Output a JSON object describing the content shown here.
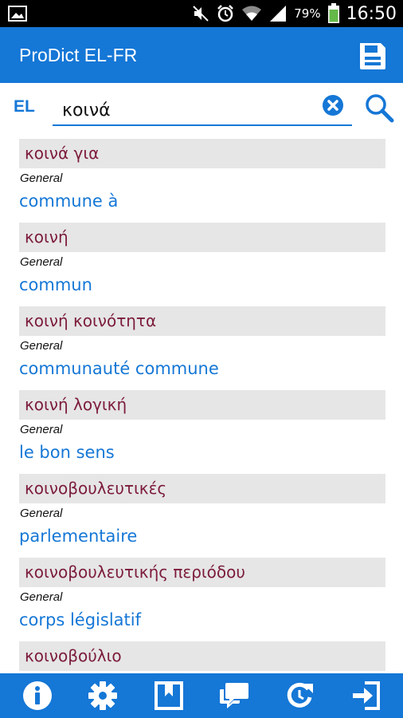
{
  "status_bar": {
    "battery_percent": "79%",
    "time": "16:50",
    "icons": [
      "image-icon",
      "mute-icon",
      "alarm-icon",
      "wifi-icon",
      "signal-icon",
      "battery-icon"
    ]
  },
  "app_bar": {
    "title": "ProDict EL-FR",
    "save_icon": "save-icon"
  },
  "search": {
    "language": "EL",
    "value": "κοινά",
    "clear_icon": "clear-icon",
    "search_icon": "search-icon"
  },
  "results": [
    {
      "headword": "κοινά για",
      "category": "General",
      "translation": "commune à"
    },
    {
      "headword": "κοινή",
      "category": "General",
      "translation": "commun"
    },
    {
      "headword": "κοινή κοινότητα",
      "category": "General",
      "translation": "communauté commune"
    },
    {
      "headword": "κοινή λογική",
      "category": "General",
      "translation": "le bon sens"
    },
    {
      "headword": "κοινοβουλευτικές",
      "category": "General",
      "translation": "parlementaire"
    },
    {
      "headword": "κοινοβουλευτικής περιόδου",
      "category": "General",
      "translation": "corps législatif"
    },
    {
      "headword": "κοινοβούλιο",
      "category": "",
      "translation": ""
    }
  ],
  "bottom_bar": {
    "icons": [
      "info-icon",
      "settings-icon",
      "bookmark-icon",
      "chat-icon",
      "refresh-icon",
      "exit-icon"
    ]
  },
  "colors": {
    "primary": "#1577d6",
    "headword": "#7c1c3a",
    "entry_background": "#e6e6e6"
  }
}
